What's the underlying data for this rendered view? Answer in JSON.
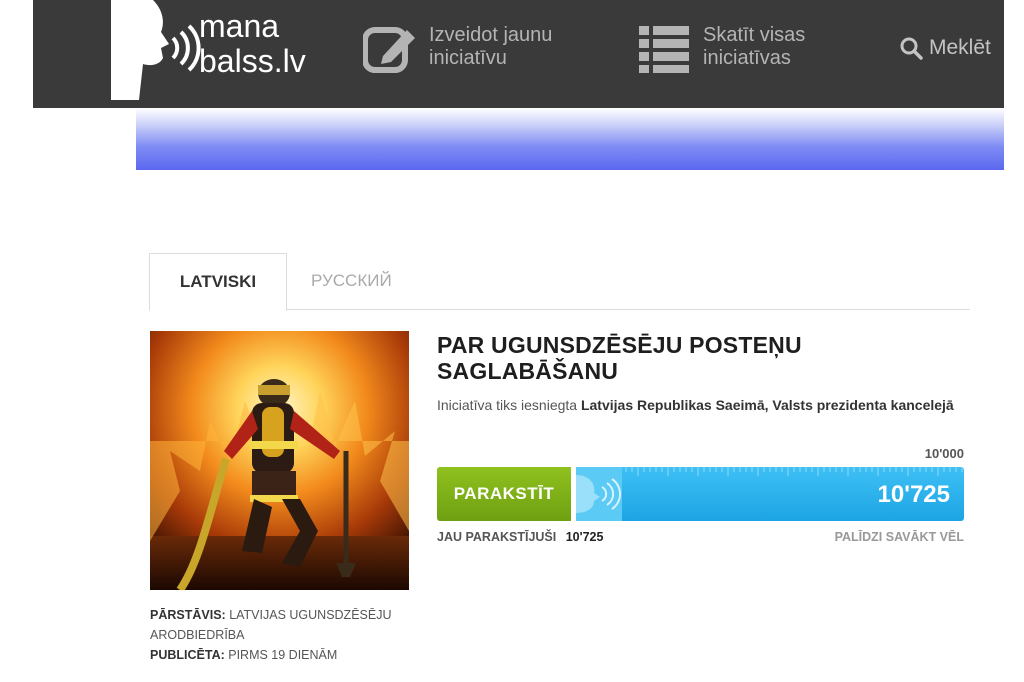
{
  "site": {
    "logo_line1": "mana",
    "logo_line2": "balss.lv"
  },
  "nav": {
    "create": {
      "line1": "Izveidot jaunu",
      "line2": "iniciatīvu",
      "icon": "edit-icon"
    },
    "list": {
      "line1": "Skatīt visas",
      "line2": "iniciatīvas",
      "icon": "list-icon"
    },
    "search": {
      "label": "Meklēt",
      "icon": "search-icon"
    }
  },
  "tabs": [
    {
      "label": "LATVISKI",
      "active": true
    },
    {
      "label": "РУССКИЙ",
      "active": false
    }
  ],
  "initiative": {
    "title_line1": "PAR UGUNSDZĒSĒJU POSTEŅU",
    "title_line2": "SAGLABĀŠANU",
    "submitted_prefix": "Iniciatīva tiks iesniegta",
    "submitted_to": "Latvijas Republikas Saeimā, Valsts prezidenta kancelejā",
    "goal": "10'000",
    "sign_button": "PARAKSTĪT",
    "count": "10'725",
    "progress_fraction": 1.0,
    "signed_label": "JAU PARAKSTĪJUŠI",
    "signed_count": "10'725",
    "help_label": "PALĪDZI SAVĀKT VĒL"
  },
  "meta": {
    "rep_label": "PĀRSTĀVIS:",
    "rep_value": "LATVIJAS UGUNSDZĒSĒJU ARODBIEDRĪBA",
    "pub_label": "PUBLICĒTA:",
    "pub_value": "PIRMS 19 DIENĀM"
  },
  "colors": {
    "topbar": "#3a3a3a",
    "sign_green": "#7db417",
    "progress_blue": "#2bb1ec"
  }
}
